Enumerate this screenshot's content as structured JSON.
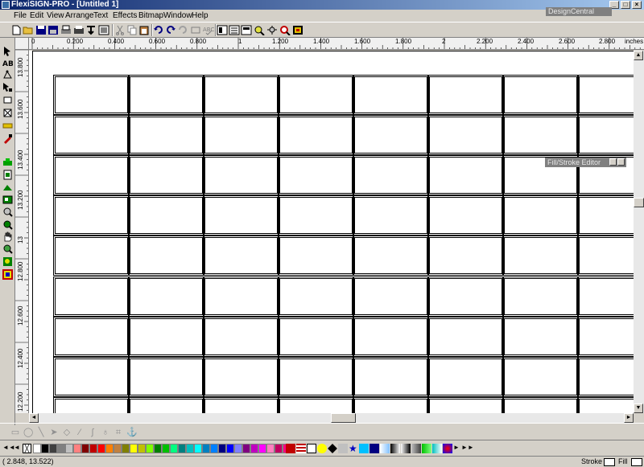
{
  "window": {
    "title": "FlexiSIGN-PRO - [Untitled 1]",
    "minimize_glyph": "_",
    "maximize_glyph": "□",
    "close_glyph": "×"
  },
  "menu": [
    "File",
    "Edit",
    "View",
    "Arrange",
    "Text",
    "Effects",
    "Bitmap",
    "Window",
    "Help"
  ],
  "design_central": {
    "title": "DesignCentral"
  },
  "toolbar_icons": [
    "new-icon",
    "open-icon",
    "save-icon",
    "save-as-icon",
    "print-icon",
    "plot-icon",
    "output-icon",
    "cut-icon",
    "copy-icon",
    "paste-icon",
    "undo-icon",
    "redo-icon",
    "delete-icon",
    "paste-special-icon",
    "spell-check-icon",
    "object-properties-icon",
    "layers-icon",
    "document-manager-icon",
    "color-tools-icon",
    "zoom-fit-icon",
    "preview-icon",
    "grid-icon"
  ],
  "tool_icons": [
    "select-arrow-icon",
    "text-tool-icon",
    "shape-node-icon",
    "pen-tool-icon",
    "rectangle-tool-icon",
    "frame-tool-icon",
    "fill-tool-icon",
    "eyedropper-icon",
    "weld-icon",
    "import-icon",
    "contour-icon",
    "bitmap-icon",
    "magnify-icon",
    "zoom-region-icon",
    "hand-pan-icon",
    "zoom-in-icon",
    "color-replace-icon",
    "fill-stroke-icon"
  ],
  "ruler": {
    "unit": "inches",
    "h_labels": [
      "0",
      "0.200",
      "0.400",
      "0.600",
      "0.800",
      "1",
      "1.200",
      "1.400",
      "1.600",
      "1.800",
      "2",
      "2.200",
      "2.400",
      "2.600",
      "2.800"
    ],
    "v_labels": [
      "13.800",
      "13.600",
      "13.400",
      "13.200",
      "13",
      "12.800",
      "12.600",
      "12.400",
      "12.200"
    ]
  },
  "fill_stroke_editor": {
    "title": "Fill/Stroke Editor"
  },
  "shape_tools": [
    "rect-select-icon",
    "lasso-icon",
    "line-icon",
    "pointer-node-icon",
    "curve-icon",
    "knife-icon",
    "brush-icon",
    "bucket-icon",
    "crop-icon",
    "anchor-icon"
  ],
  "palette": {
    "nav_left": [
      "◄◄",
      "◄"
    ],
    "nav_right": [
      "►",
      "►►"
    ],
    "colors": [
      "#ffffff",
      "#000000",
      "#404040",
      "#808080",
      "#c0c0c0",
      "#ff8080",
      "#800000",
      "#c00000",
      "#ff0000",
      "#ff8000",
      "#c08040",
      "#808000",
      "#ffff00",
      "#c0c000",
      "#80ff00",
      "#008000",
      "#00c000",
      "#00ff80",
      "#008080",
      "#00c0c0",
      "#00ffff",
      "#0080c0",
      "#0080ff",
      "#000080",
      "#0000ff",
      "#8080ff",
      "#800080",
      "#c000c0",
      "#ff00ff",
      "#ff80c0",
      "#c00060",
      "#ff0080"
    ]
  },
  "status": {
    "coords": "2.848,   13.522)",
    "stroke_label": "Stroke",
    "fill_label": "Fill"
  }
}
